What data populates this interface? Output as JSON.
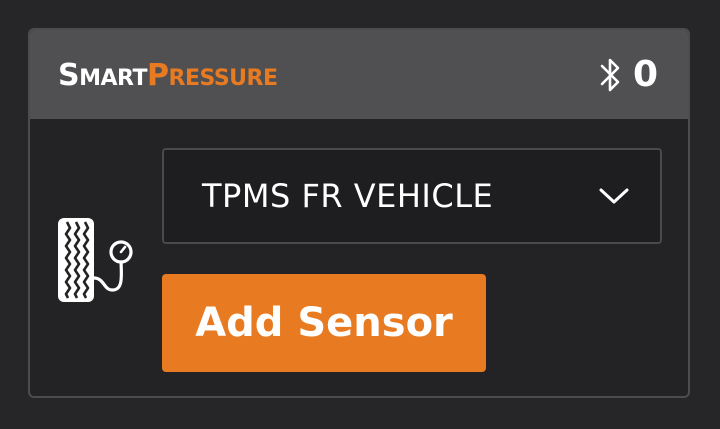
{
  "header": {
    "logo": {
      "smart_cap": "S",
      "smart_rest": "MART",
      "pressure_cap": "P",
      "pressure_rest": "RESSURE"
    },
    "bluetooth_icon": "bluetooth-icon",
    "connected_count": "0"
  },
  "sensor": {
    "icon": "tire-pressure-gauge-icon",
    "selected_vehicle": "TPMS FR VEHICLE",
    "dropdown_icon": "chevron-down-icon",
    "add_button_label": "Add Sensor"
  },
  "colors": {
    "accent": "#e87b21",
    "header_bg": "#505053",
    "page_bg": "#262628",
    "card_bg": "#232325",
    "text": "#ffffff"
  }
}
